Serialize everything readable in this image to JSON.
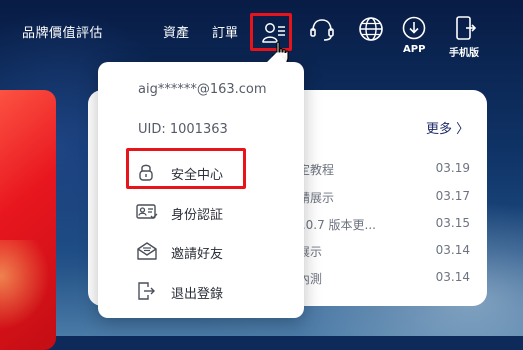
{
  "header": {
    "brand": "品牌價值評估",
    "nav": {
      "assets": "資產",
      "orders": "訂單"
    },
    "app_label": "APP",
    "mobile_label": "手机版"
  },
  "news": {
    "more": "更多 〉",
    "items": [
      {
        "title": "綁定教程",
        "date": "03.19"
      },
      {
        "title": "邀請展示",
        "date": "03.17"
      },
      {
        "title": "V1.0.7 版本更...",
        "date": "03.15"
      },
      {
        "title": "品展示",
        "date": "03.14"
      },
      {
        "title": "線內測",
        "date": "03.14"
      }
    ]
  },
  "dropdown": {
    "email": "aig******@163.com",
    "uid": "UID: 1001363",
    "items": [
      {
        "label": "安全中心",
        "icon": "lock-icon"
      },
      {
        "label": "身份認証",
        "icon": "id-card-icon"
      },
      {
        "label": "邀請好友",
        "icon": "envelope-icon"
      },
      {
        "label": "退出登錄",
        "icon": "logout-icon"
      }
    ]
  },
  "colors": {
    "highlight": "#e8141b",
    "nav_bg": "#0d2a5a"
  }
}
